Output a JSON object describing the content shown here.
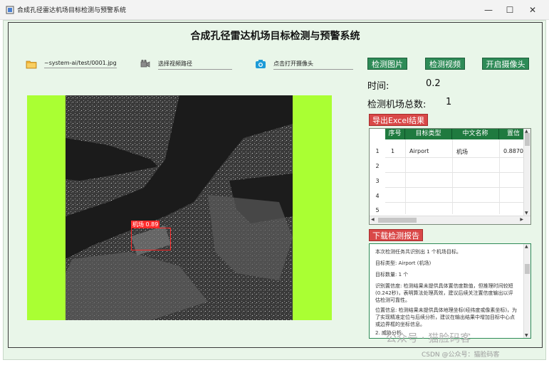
{
  "window": {
    "title": "合成孔径雷达机场目标检测与预警系统",
    "minimize": "—",
    "maximize": "☐",
    "close": "✕"
  },
  "header": {
    "title": "合成孔径雷达机场目标检测与预警系统"
  },
  "inputs": {
    "image_path": "~system-ai/test/0001.jpg",
    "video_path": "选择视频路径",
    "camera": "点击打开摄像头"
  },
  "buttons": {
    "detect_image": "检测图片",
    "detect_video": "检测视频",
    "open_camera": "开启摄像头",
    "export_excel": "导出Excel结果",
    "download_report": "下载检测报告"
  },
  "stats": {
    "time_label": "时间:",
    "time_value": "0.2",
    "count_label": "检测机场总数:",
    "count_value": "1"
  },
  "detection_overlay": {
    "label": "机场 0.89"
  },
  "table": {
    "headers": [
      "序号",
      "目标类型",
      "中文名称",
      "置信"
    ],
    "row_numbers": [
      "1",
      "2",
      "3",
      "4",
      "5"
    ],
    "rows": [
      [
        "1",
        "Airport",
        "机场",
        "0.8870"
      ]
    ]
  },
  "report": {
    "lines": [
      "本次检测任务共识别出 1 个机场目标。",
      "目标类型:  Airport (机场)",
      "目标数量:  1 个",
      "识别置信度: 检测结果未提供具体置信度数值，但推理时间较短 (0.242秒)，表明算法处理高效，建议后续关注置信度输出以评估检测可靠性。",
      "位置信息: 检测结果未提供具体地理坐标(经纬度或像素坐标)，为了实现精准定位与后续分析，建议在输出结果中增加目标中心点或边界框的坐标信息。",
      "2. 威胁分析"
    ]
  },
  "watermark": {
    "main": "公众号 · 猫脸码客",
    "sub": "CSDN @公众号：猫脸码客"
  },
  "colors": {
    "accent_green": "#2e8b57",
    "accent_red": "#d94848",
    "panel_lime": "#aaff33",
    "bg": "#e9f6e9"
  }
}
